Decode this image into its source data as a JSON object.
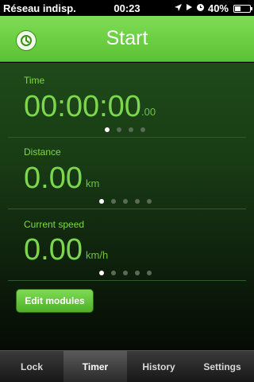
{
  "status_bar": {
    "carrier": "Réseau indisp.",
    "time": "00:23",
    "battery": "40%",
    "battery_level": 0.4,
    "icons": [
      "location-arrow-icon",
      "play-icon",
      "alarm-icon"
    ]
  },
  "header": {
    "title": "Start",
    "left_icon": "clock-icon"
  },
  "modules": [
    {
      "label": "Time",
      "value": "00:00:00",
      "unit": ".00",
      "page_count": 4,
      "active_page": 0
    },
    {
      "label": "Distance",
      "value": "0.00",
      "unit": "km",
      "page_count": 5,
      "active_page": 0
    },
    {
      "label": "Current speed",
      "value": "0.00",
      "unit": "km/h",
      "page_count": 5,
      "active_page": 0
    }
  ],
  "edit_button": "Edit modules",
  "tabs": [
    {
      "label": "Lock",
      "selected": false
    },
    {
      "label": "Timer",
      "selected": true
    },
    {
      "label": "History",
      "selected": false
    },
    {
      "label": "Settings",
      "selected": false
    }
  ],
  "colors": {
    "accent_green": "#6fd140",
    "value_green": "#7cd74e"
  }
}
